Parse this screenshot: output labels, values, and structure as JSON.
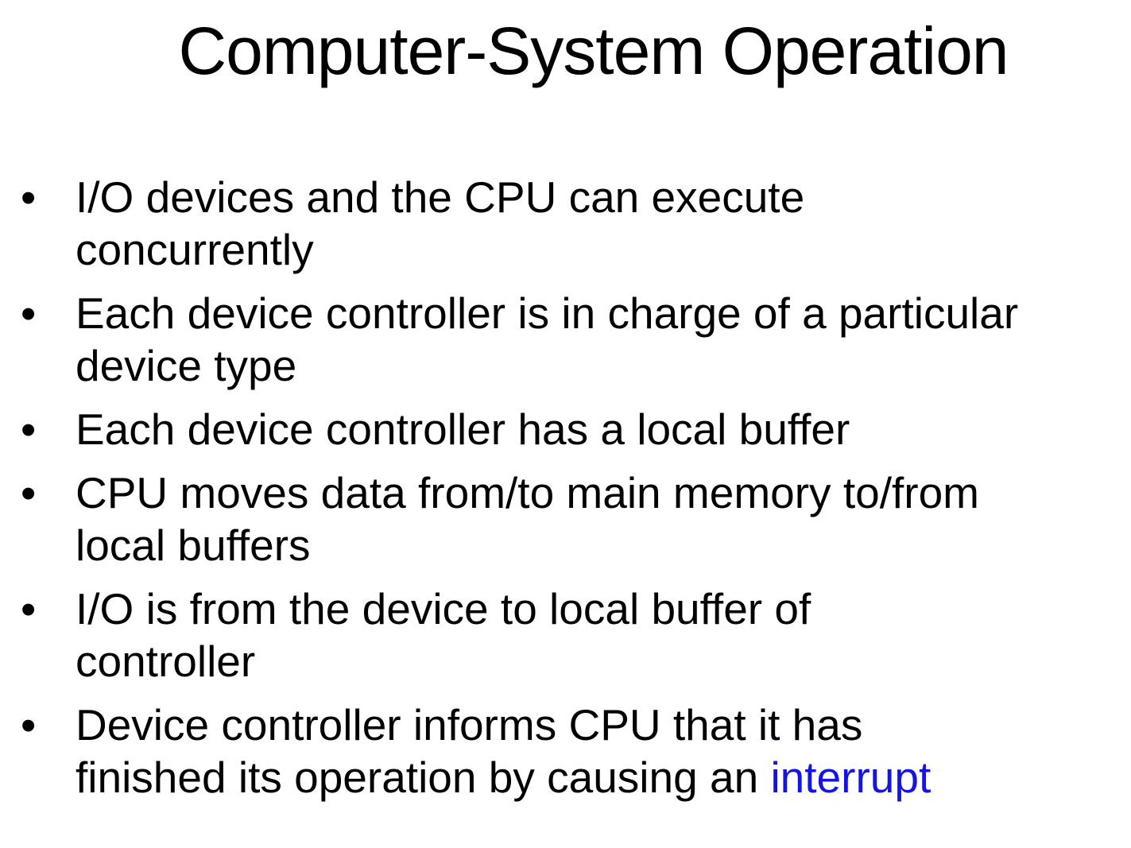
{
  "title": "Computer-System Operation",
  "bullet_glyph": "•",
  "bullets": [
    {
      "line1": "I/O devices and the CPU can execute",
      "line2": "concurrently"
    },
    {
      "line1": "Each device controller is in charge of a particular",
      "line2": "device type"
    },
    {
      "line1": "Each device controller has a local buffer"
    },
    {
      "line1": "CPU moves data from/to main memory to/from",
      "line2": "local buffers"
    },
    {
      "line1": "I/O is from the device to local buffer of",
      "line2": "controller"
    },
    {
      "line1": "Device controller informs CPU that it has",
      "line2": "finished its operation by causing an ",
      "highlight": "interrupt"
    }
  ],
  "colors": {
    "background": "#ffffff",
    "text": "#000000",
    "highlight": "#1414e6"
  }
}
